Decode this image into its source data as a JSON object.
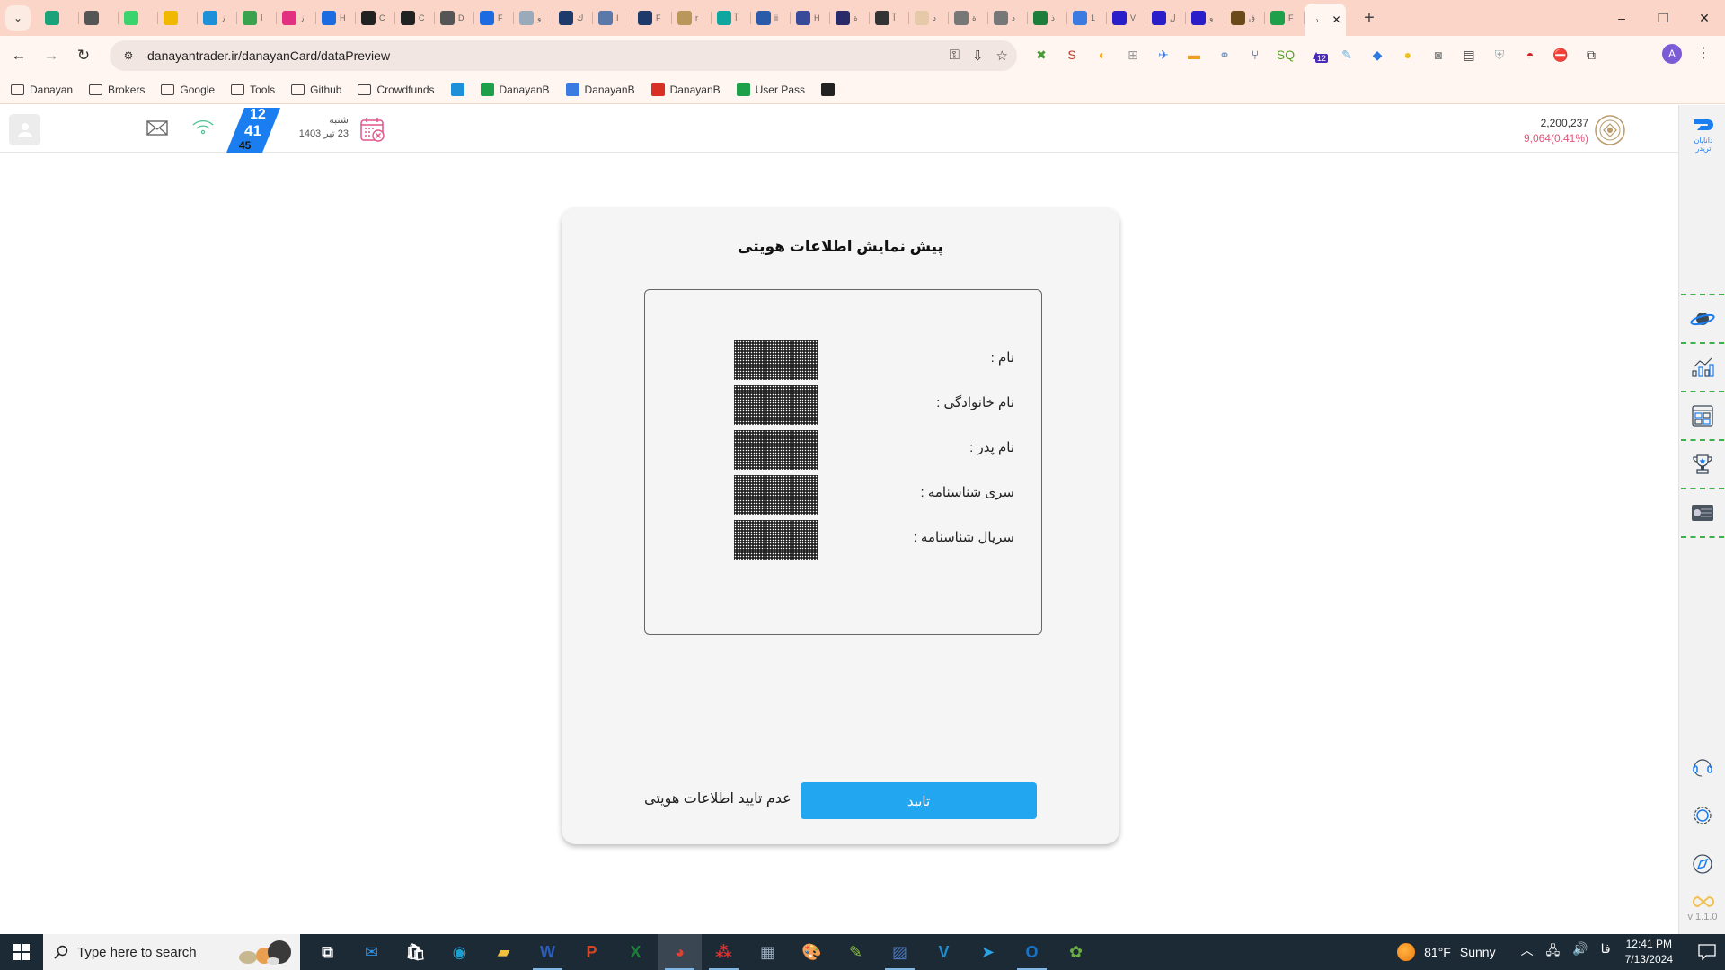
{
  "browser": {
    "tabs": [
      {
        "name": "tab-b",
        "color": "#1aa37a",
        "label": ""
      },
      {
        "name": "tab-tray",
        "color": "#555",
        "label": ""
      },
      {
        "name": "tab-green-dot",
        "color": "#3bd36b",
        "label": ""
      },
      {
        "name": "tab-arrows",
        "color": "#f0b800",
        "label": ""
      },
      {
        "name": "tab-1",
        "color": "#1e90d8",
        "label": "ز"
      },
      {
        "name": "tab-2",
        "color": "#3aa14c",
        "label": "ا"
      },
      {
        "name": "tab-3",
        "color": "#e0307f",
        "label": "ز"
      },
      {
        "name": "tab-4",
        "color": "#1c6be0",
        "label": "H"
      },
      {
        "name": "tab-github",
        "color": "#222",
        "label": "C"
      },
      {
        "name": "tab-sa",
        "color": "#222",
        "label": "C"
      },
      {
        "name": "tab-5",
        "color": "#555",
        "label": "D"
      },
      {
        "name": "tab-6",
        "color": "#1c6be0",
        "label": "F"
      },
      {
        "name": "tab-7",
        "color": "#9ab",
        "label": "و"
      },
      {
        "name": "tab-8",
        "color": "#1e3a6b",
        "label": "ك"
      },
      {
        "name": "tab-9",
        "color": "#5a78a8",
        "label": "I"
      },
      {
        "name": "tab-10",
        "color": "#1e3a6b",
        "label": "F"
      },
      {
        "name": "tab-11",
        "color": "#b9975b",
        "label": "r"
      },
      {
        "name": "tab-12",
        "color": "#0fa6a0",
        "label": "آ"
      },
      {
        "name": "tab-13",
        "color": "#2a5ba8",
        "label": "ii"
      },
      {
        "name": "tab-14",
        "color": "#3a4a9a",
        "label": "H"
      },
      {
        "name": "tab-15",
        "color": "#2a2a6b",
        "label": "ة"
      },
      {
        "name": "tab-16",
        "color": "#333",
        "label": "آ"
      },
      {
        "name": "tab-17",
        "color": "#e6c9a8",
        "label": "د"
      },
      {
        "name": "tab-18",
        "color": "#777",
        "label": "ة"
      },
      {
        "name": "tab-19",
        "color": "#777",
        "label": "د"
      },
      {
        "name": "tab-20",
        "color": "#1e7d3a",
        "label": "ذ"
      },
      {
        "name": "tab-21",
        "color": "#3b7ae0",
        "label": "1"
      },
      {
        "name": "tab-22",
        "color": "#2a1ec8",
        "label": "V"
      },
      {
        "name": "tab-23",
        "color": "#2a1ec8",
        "label": "ل"
      },
      {
        "name": "tab-24",
        "color": "#2a1ec8",
        "label": "و"
      },
      {
        "name": "tab-25",
        "color": "#6b4a1a",
        "label": "ق"
      },
      {
        "name": "tab-26",
        "color": "#1ea04a",
        "label": "F"
      }
    ],
    "active_tab": {
      "label": "د",
      "close": "✕"
    },
    "new_tab": "+",
    "window_controls": {
      "minimize": "–",
      "restore": "❐",
      "close": "✕"
    },
    "nav": {
      "back": "←",
      "forward": "→",
      "reload": "↻"
    },
    "url": "danayantrader.ir/danayanCard/dataPreview",
    "omnibox_icons": {
      "key": "⚿",
      "install": "⇩",
      "star": "☆"
    },
    "extensions": [
      {
        "name": "ext-x",
        "glyph": "✖",
        "color": "#4a9a3a"
      },
      {
        "name": "ext-seo",
        "glyph": "S",
        "color": "#c0392b"
      },
      {
        "name": "ext-drop",
        "glyph": "◐",
        "color": "#f5a623"
      },
      {
        "name": "ext-plus",
        "glyph": "⊞",
        "color": "#999"
      },
      {
        "name": "ext-rocket",
        "glyph": "✈",
        "color": "#3b7ae0"
      },
      {
        "name": "ext-box",
        "glyph": "▬",
        "color": "#f0a020"
      },
      {
        "name": "ext-link",
        "glyph": "⚭",
        "color": "#6a8fb8"
      },
      {
        "name": "ext-fork",
        "glyph": "⑂",
        "color": "#1e3a6b"
      },
      {
        "name": "ext-sq",
        "glyph": "SQ",
        "color": "#5aa02a"
      },
      {
        "name": "ext-badge",
        "glyph": "▲",
        "color": "#4a2ab8",
        "badge": "12"
      },
      {
        "name": "ext-feather",
        "glyph": "✎",
        "color": "#6ab0e0"
      },
      {
        "name": "ext-tag",
        "glyph": "◆",
        "color": "#2a7ae0"
      },
      {
        "name": "ext-duck",
        "glyph": "●",
        "color": "#f0c020"
      },
      {
        "name": "ext-camera",
        "glyph": "◙",
        "color": "#888"
      },
      {
        "name": "ext-news",
        "glyph": "▤",
        "color": "#333"
      },
      {
        "name": "ext-shield",
        "glyph": "⛨",
        "color": "#9aa"
      },
      {
        "name": "ext-pokeball",
        "glyph": "◓",
        "color": "#d02020"
      },
      {
        "name": "ext-block",
        "glyph": "⛔",
        "color": "#d02020"
      },
      {
        "name": "ext-puzzle",
        "glyph": "⧉",
        "color": "#333"
      }
    ],
    "profile_initial": "A",
    "menu": "⋮",
    "bookmarks": [
      {
        "label": "Danayan",
        "type": "folder"
      },
      {
        "label": "Brokers",
        "type": "folder"
      },
      {
        "label": "Google",
        "type": "folder"
      },
      {
        "label": "Tools",
        "type": "folder"
      },
      {
        "label": "Github",
        "type": "folder"
      },
      {
        "label": "Crowdfunds",
        "type": "folder"
      },
      {
        "label": "",
        "type": "icon",
        "color": "#1e90d8"
      },
      {
        "label": "DanayanB",
        "type": "sheet",
        "color": "#1ea04a"
      },
      {
        "label": "DanayanB",
        "type": "doc",
        "color": "#3b7ae0"
      },
      {
        "label": "DanayanB",
        "type": "gmail",
        "color": "#d93025"
      },
      {
        "label": "User Pass",
        "type": "sheet",
        "color": "#1ea04a"
      },
      {
        "label": "",
        "type": "icon",
        "color": "#222"
      }
    ]
  },
  "header": {
    "clock": {
      "hour": "12",
      "minute": "41",
      "second": "45"
    },
    "date": {
      "weekday": "شنبه",
      "full": "23 تیر 1403"
    },
    "index": {
      "value": "2,200,237",
      "change": "9,064(0.41%)"
    },
    "brand": {
      "line1": "دانایان",
      "line2": "تریدر"
    }
  },
  "sidebar": {
    "items": [
      {
        "name": "planet"
      },
      {
        "name": "chart"
      },
      {
        "name": "dashboard"
      },
      {
        "name": "trophy"
      },
      {
        "name": "card"
      }
    ],
    "bottom": [
      {
        "name": "support"
      },
      {
        "name": "settings"
      },
      {
        "name": "compass"
      }
    ],
    "version": "v 1.1.0"
  },
  "card": {
    "title": "پیش نمایش اطلاعات هویتی",
    "fields": [
      {
        "label": "نام :",
        "value": "[redacted]"
      },
      {
        "label": "نام خانوادگی :",
        "value": "[redacted]"
      },
      {
        "label": "نام پدر :",
        "value": "[redacted]"
      },
      {
        "label": "سری شناسنامه :",
        "value": "[redacted]"
      },
      {
        "label": "سریال شناسنامه :",
        "value": "[redacted]"
      }
    ],
    "confirm_label": "تایید",
    "reject_label": "عدم تایید اطلاعات هویتی",
    "accent": "#22a6f0"
  },
  "taskbar": {
    "search_placeholder": "Type here to search",
    "apps": [
      {
        "name": "task-view",
        "glyph": "⧉",
        "color": "#fff"
      },
      {
        "name": "mail",
        "glyph": "✉",
        "color": "#2e8fe0"
      },
      {
        "name": "store",
        "glyph": "🛍",
        "color": "#fff"
      },
      {
        "name": "edge",
        "glyph": "◉",
        "color": "#1aa0d0"
      },
      {
        "name": "explorer",
        "glyph": "▰",
        "color": "#f0c040"
      },
      {
        "name": "word",
        "glyph": "W",
        "color": "#2b5cb8"
      },
      {
        "name": "powerpoint",
        "glyph": "P",
        "color": "#d24726"
      },
      {
        "name": "excel",
        "glyph": "X",
        "color": "#1e7d3a"
      },
      {
        "name": "chrome",
        "glyph": "◕",
        "color": "#e04030",
        "active": true
      },
      {
        "name": "network-app",
        "glyph": "⁂",
        "color": "#e03030"
      },
      {
        "name": "calculator",
        "glyph": "▦",
        "color": "#9ab"
      },
      {
        "name": "paint",
        "glyph": "🎨",
        "color": "#e0c090"
      },
      {
        "name": "notepad-plus",
        "glyph": "✎",
        "color": "#8ac040"
      },
      {
        "name": "image-app",
        "glyph": "▨",
        "color": "#4a7ac0"
      },
      {
        "name": "vpn",
        "glyph": "V",
        "color": "#1a8fd0"
      },
      {
        "name": "telegram",
        "glyph": "➤",
        "color": "#2aa3e0"
      },
      {
        "name": "outlook",
        "glyph": "O",
        "color": "#1a73c8"
      },
      {
        "name": "green-app",
        "glyph": "✿",
        "color": "#6ab040"
      }
    ],
    "weather": {
      "temp": "81°F",
      "desc": "Sunny"
    },
    "lang": "فا",
    "time": "12:41 PM",
    "date": "7/13/2024"
  }
}
